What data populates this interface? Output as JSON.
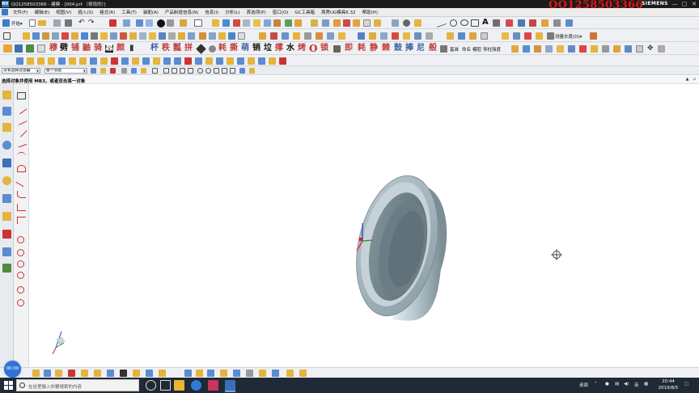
{
  "window": {
    "title": "QQ1258503366 - 建模 - [004.prt （修改的）]",
    "app_icon": "NX",
    "watermark": "QQ1258503366",
    "brand": "SIEMENS",
    "minimize": "—",
    "restore": "▢",
    "close": "✕"
  },
  "menubar": {
    "items": [
      "文件(F)",
      "编辑(E)",
      "视图(V)",
      "插入(S)",
      "格式(R)",
      "工具(T)",
      "装配(A)",
      "产品制造信息(N)",
      "信息(I)",
      "分析(L)",
      "首选项(P)",
      "窗口(O)",
      "GC工具箱",
      "燕秀UG模具6.32",
      "帮助(H)"
    ]
  },
  "toolbar1": {
    "start_label": "开始▾"
  },
  "toolbar2": {
    "measure_label": "测量长度(D)▾"
  },
  "toolbar3": {
    "chars": [
      "穆",
      "劈",
      "铺",
      "鼬",
      "骑",
      "靠",
      "颜",
      "杯",
      "秩",
      "瓢",
      "拼",
      "耗",
      "撕",
      "萌",
      "销",
      "垃",
      "撑",
      "水",
      "烤",
      "O",
      "锁",
      "即",
      "耗",
      "静",
      "棘",
      "鼓",
      "捧",
      "尼",
      "般"
    ],
    "labels": [
      "基准",
      "命名",
      "模腔",
      "导柱强度"
    ]
  },
  "selection_bar": {
    "filter_value": "没有选择过滤器",
    "scope_value": "整个装配"
  },
  "cue_line": {
    "text": "选择对象并使用 MB3，或者双击某一对象"
  },
  "taskbar": {
    "search_placeholder": "在这里输入你要搜索的内容",
    "tray_desktop": "桌面",
    "tray_lang": "英",
    "time": "20:44",
    "date": "2019/8/5",
    "recording": "00:00"
  },
  "colors": {
    "part_face": "#b4c3cb",
    "part_inner": "#6e8088",
    "part_dark": "#4f5e66",
    "accent_blue": "#2f6fb8",
    "watermark_red": "#e01818"
  }
}
